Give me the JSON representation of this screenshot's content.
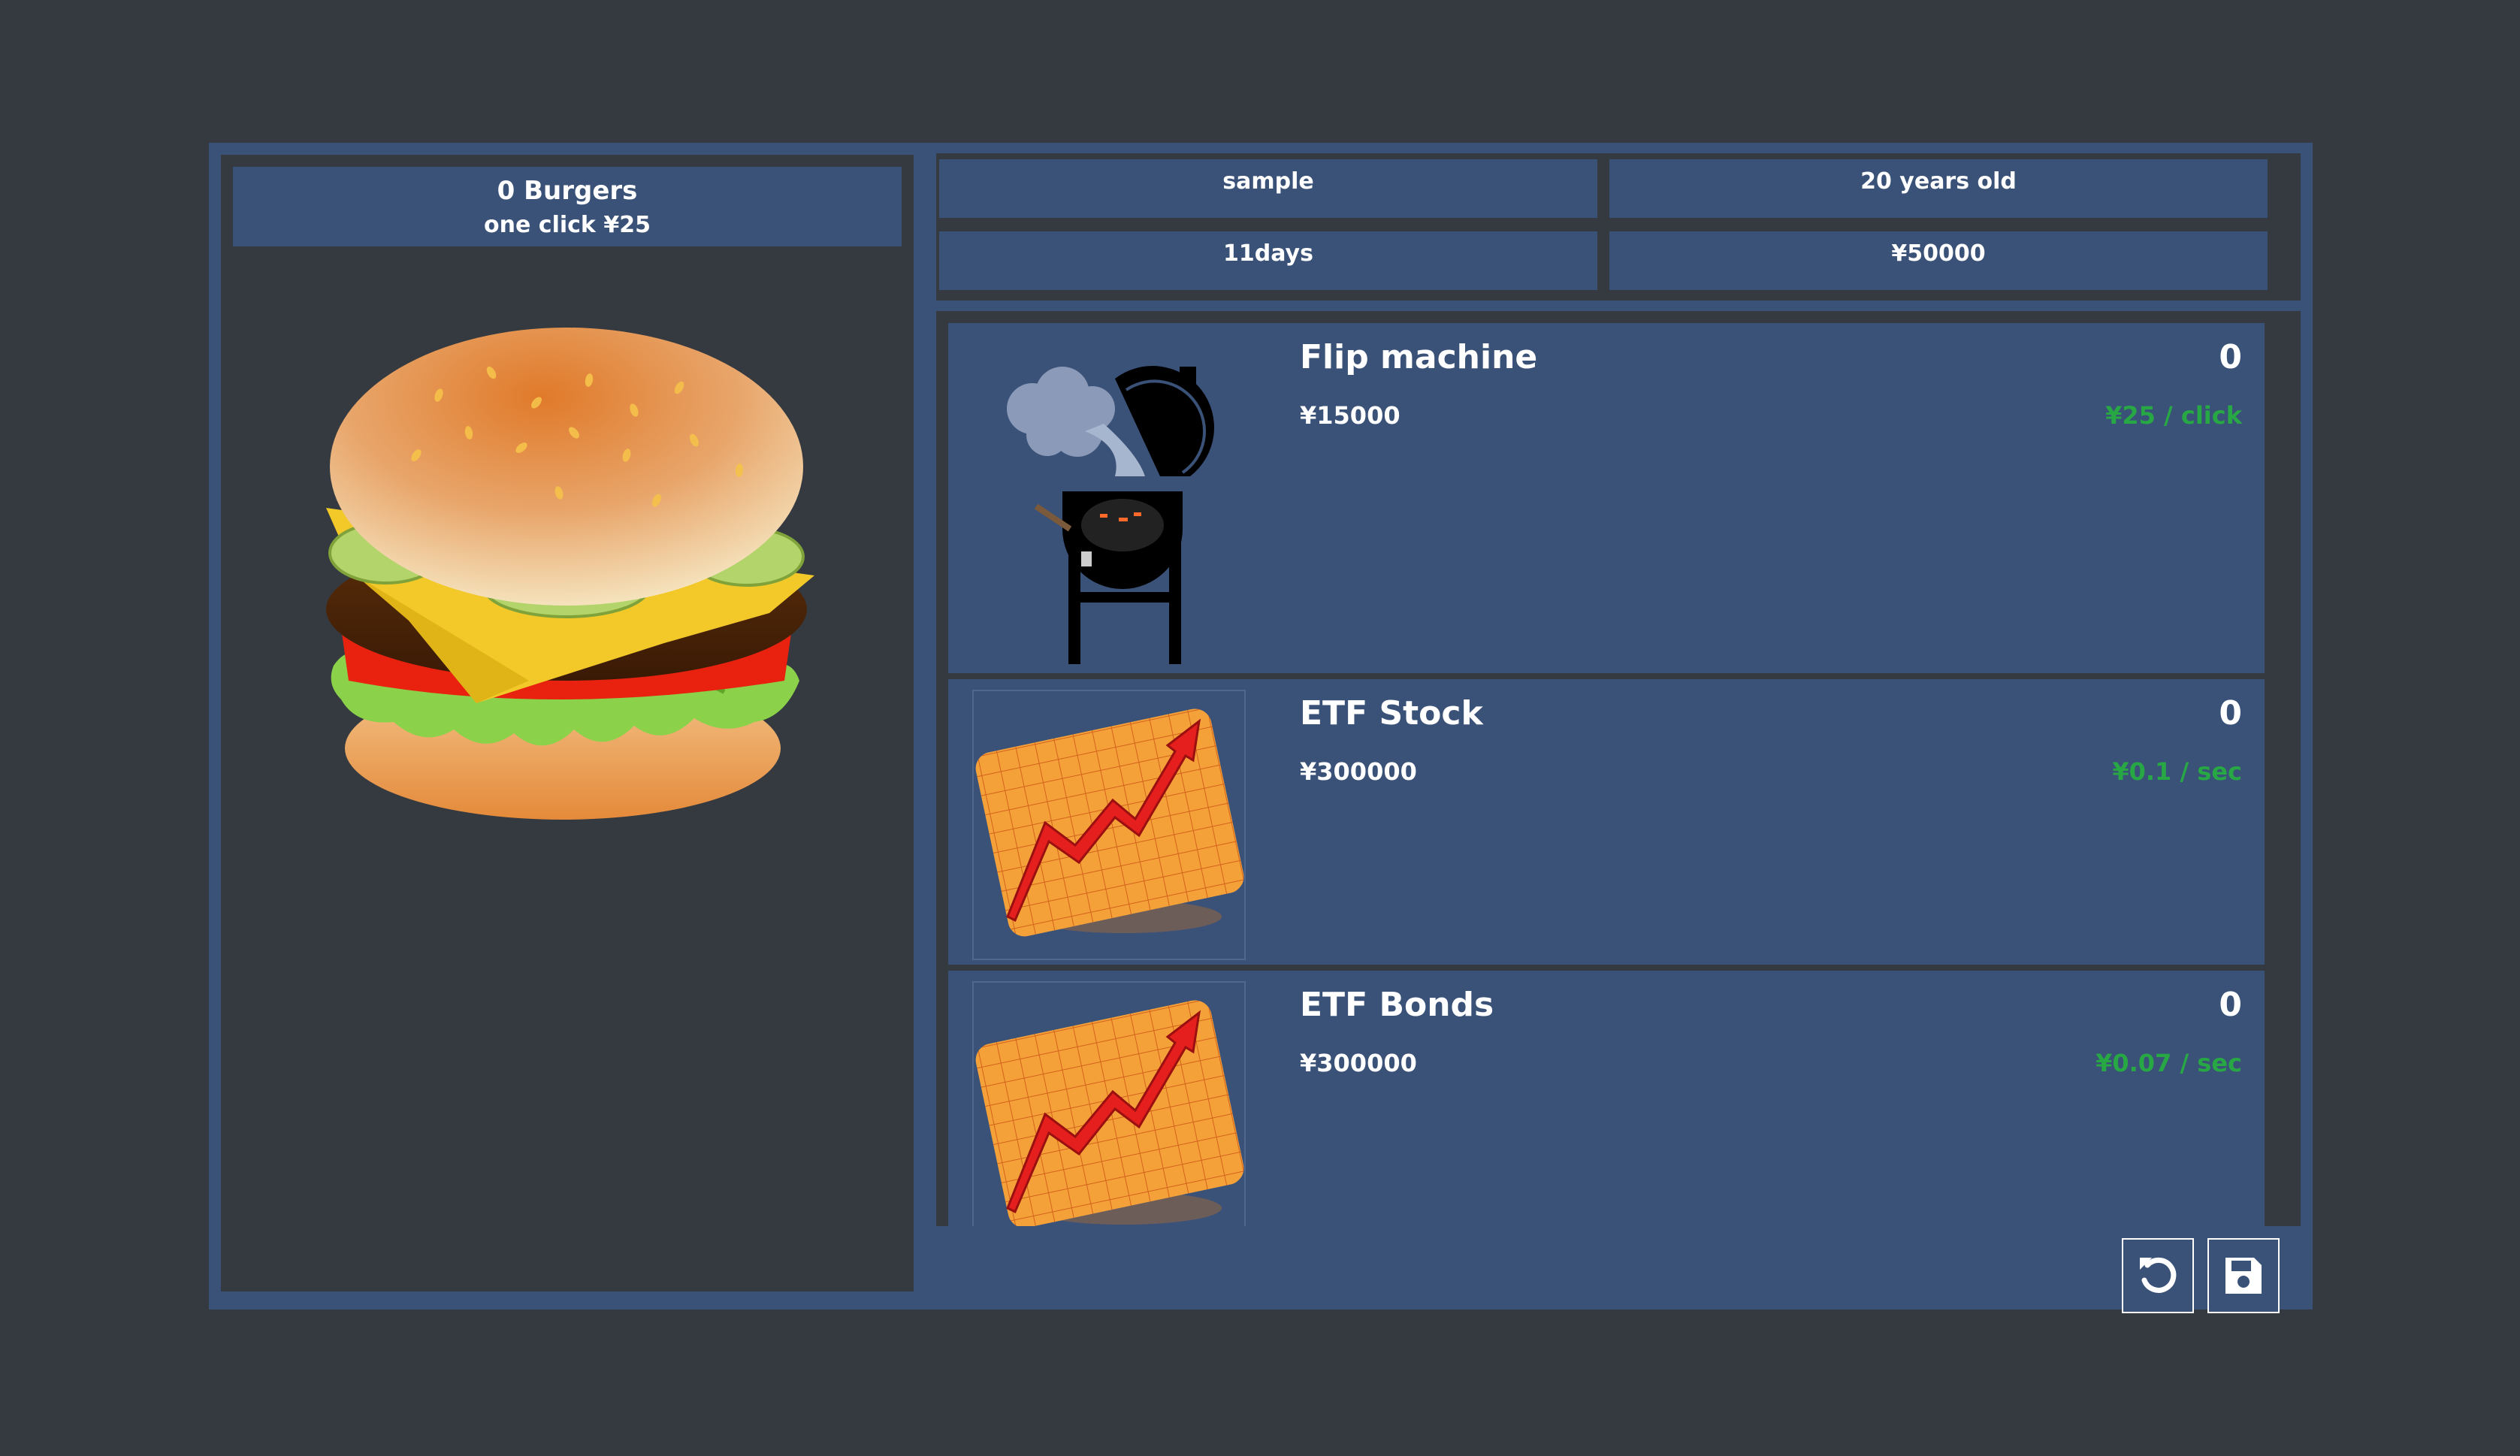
{
  "counter": {
    "count": "0 Burgers",
    "per_click": "one click ¥25"
  },
  "info": {
    "name": "sample",
    "age": "20 years old",
    "days": "11days",
    "money": "¥50000"
  },
  "items": [
    {
      "name": "Flip machine",
      "price": "¥15000",
      "qty": "0",
      "rate": "¥25 / click",
      "icon": "grill-icon"
    },
    {
      "name": "ETF Stock",
      "price": "¥300000",
      "qty": "0",
      "rate": "¥0.1 / sec",
      "icon": "chart-up-icon"
    },
    {
      "name": "ETF Bonds",
      "price": "¥300000",
      "qty": "0",
      "rate": "¥0.07 / sec",
      "icon": "chart-up-icon"
    }
  ],
  "buttons": {
    "reset": "reset-icon",
    "save": "save-icon"
  },
  "colors": {
    "background": "#343a40",
    "panel": "#3a5178",
    "accent_green": "#28a745"
  }
}
